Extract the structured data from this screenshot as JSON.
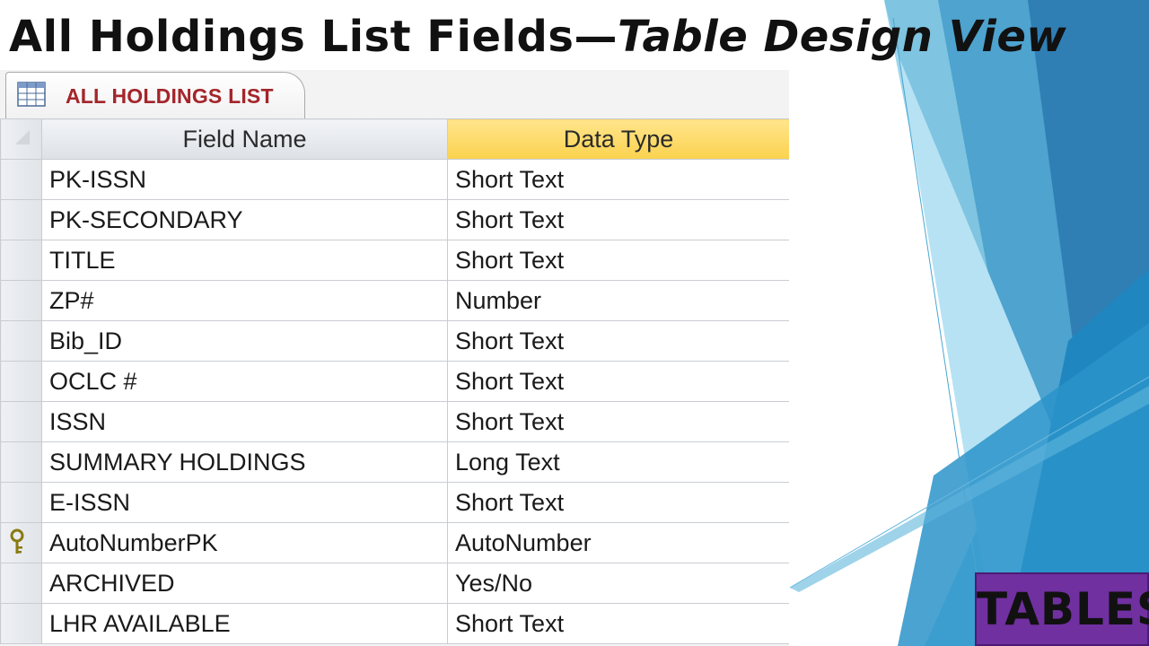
{
  "slide": {
    "title_main": "All Holdings List Fields—",
    "title_emphasis": "Table Design View",
    "badge_label": "TABLES"
  },
  "colors": {
    "tab_label": "#a4252a",
    "datatype_header": "#fbd24e",
    "badge": "#7030a0"
  },
  "window": {
    "tab_label": "ALL HOLDINGS LIST",
    "tab_icon": "table-icon"
  },
  "grid": {
    "headers": {
      "field_name": "Field Name",
      "data_type": "Data Type"
    },
    "rows": [
      {
        "field": "PK-ISSN",
        "type": "Short Text"
      },
      {
        "field": "PK-SECONDARY",
        "type": "Short Text"
      },
      {
        "field": "TITLE",
        "type": "Short Text"
      },
      {
        "field": "ZP#",
        "type": "Number"
      },
      {
        "field": "Bib_ID",
        "type": "Short Text"
      },
      {
        "field": "OCLC #",
        "type": "Short Text"
      },
      {
        "field": "ISSN",
        "type": "Short Text"
      },
      {
        "field": "SUMMARY HOLDINGS",
        "type": "Long Text"
      },
      {
        "field": "E-ISSN",
        "type": "Short Text"
      },
      {
        "field": "AutoNumberPK",
        "type": "AutoNumber",
        "primary_key": true
      },
      {
        "field": "ARCHIVED",
        "type": "Yes/No"
      },
      {
        "field": "LHR AVAILABLE",
        "type": "Short Text"
      }
    ]
  }
}
